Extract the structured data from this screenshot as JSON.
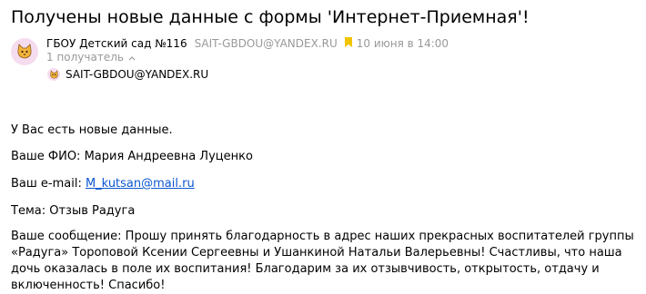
{
  "message": {
    "subject": "Получены новые данные с формы 'Интернет-Приемная'!",
    "sender_name": "ГБОУ Детский сад №116",
    "sender_email": "SAIT-GBDOU@YANDEX.RU",
    "date": "10 июня в 14:00",
    "recipients_count": "1 получатель",
    "recipient_email": "SAIT-GBDOU@YANDEX.RU",
    "icons": {
      "avatar": "cat-avatar-icon",
      "bookmark": "bookmark-icon",
      "chevron": "chevron-up-icon"
    }
  },
  "body": {
    "intro": "У Вас есть новые данные.",
    "fio": "Ваше ФИО: Мария Андреевна Луценко",
    "email_label": "Ваш e-mail: ",
    "email_value": "M_kutsan@mail.ru",
    "topic": "Тема: Отзыв Радуга",
    "message_text": "Ваше сообщение: Прошу принять благодарность в адрес наших прекрасных воспитателей группы «Радуга» Тороповой Ксении Сергеевны и Ушанкиной Натальи Валерьевны! Счастливы, что наша дочь оказалась в поле их воспитания! Благодарим за их отзывчивость, открытость, отдачу и включенность! Спасибо!"
  },
  "colors": {
    "meta_gray": "#999999",
    "link_blue": "#0b57d0",
    "avatar_bg": "#f6dcef",
    "bookmark_yellow": "#f0c400"
  }
}
